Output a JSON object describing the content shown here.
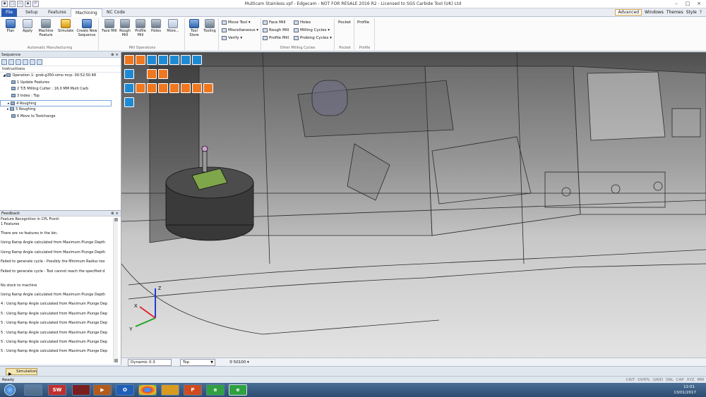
{
  "window": {
    "title": "Multicam Stainless.vpf - Edgecam - NOT FOR RESALE 2016 R2 - Licensed to SGS Carbide Tool (UK) Ltd",
    "controls": {
      "minimize": "–",
      "maximize": "□",
      "close": "×"
    }
  },
  "tabs": [
    "File",
    "Setup",
    "Features",
    "Machining",
    "NC Code"
  ],
  "active_tab": "Machining",
  "right_menu": {
    "advanced": "Advanced",
    "windows": "Windows",
    "themes": "Themes",
    "style": "Style"
  },
  "ribbon": {
    "automatic": {
      "label": "Automatic Manufacturing",
      "buttons": [
        {
          "label": "Plan",
          "icon": "plan-icon"
        },
        {
          "label": "Apply",
          "icon": "apply-icon"
        },
        {
          "label": "Machine Feature",
          "icon": "machine-feature-icon"
        },
        {
          "label": "Simulate",
          "icon": "simulate-icon"
        },
        {
          "label": "Create New Sequence",
          "icon": "new-sequence-icon"
        }
      ]
    },
    "mill_ops": {
      "label": "Mill Operations",
      "buttons": [
        {
          "label": "Face Mill",
          "icon": "face-mill-icon"
        },
        {
          "label": "Rough Mill",
          "icon": "rough-mill-icon"
        },
        {
          "label": "Profile Mill",
          "icon": "profile-mill-icon"
        },
        {
          "label": "Holes",
          "icon": "holes-icon"
        },
        {
          "label": "More...",
          "icon": "more-icon"
        }
      ]
    },
    "tool": {
      "buttons": [
        {
          "label": "Tool Store",
          "icon": "tool-store-icon"
        },
        {
          "label": "Tooling",
          "icon": "tooling-icon"
        }
      ]
    },
    "small": {
      "move_tool": "Move Tool",
      "miscellaneous": "Miscellaneous",
      "verify": "Verify"
    },
    "cycles": {
      "label": "Other Milling Cycles",
      "face_mill": "Face Mill",
      "rough_mill": "Rough Mill",
      "profile_mill": "Profile Mill",
      "holes": "Holes",
      "milling_cycles": "Milling Cycles",
      "probing_cycles": "Probing Cycles"
    },
    "pocket": {
      "button": "Pocket",
      "label": "Pocket"
    },
    "profile": {
      "button": "Profile",
      "label": "Profile"
    }
  },
  "sequence": {
    "title": "Sequence",
    "instructions_header": "Instructions",
    "tree": [
      "Operation 1: grob-g350-simo mcp: 00:52:50.48",
      "1 Update Features",
      "2 T/5 Milling Cutter : 16.0 MM Multi Carb",
      "3 Index : Top",
      "4 Roughing",
      "5 Roughing",
      "6 Move to Toolchange"
    ]
  },
  "feedback": {
    "title": "Feedback",
    "lines": [
      "Feature Recognition in CPL Fronti",
      " 1 Features",
      "",
      "There are no features in the bin.",
      "",
      "Using Ramp Angle calculated from Maximum Plunge Depth",
      "",
      "Using Ramp Angle calculated from Maximum Plunge Depth",
      "",
      "Failed to generate cycle - Possibly the Minimum Radius too",
      "",
      "Failed to generate cycle - Tool cannot reach the specified d",
      "",
      "",
      "No stock to machine",
      "",
      "Using Ramp Angle calculated from Maximum Plunge Depth",
      "",
      "4 : Using Ramp Angle calculated from Maximum Plunge Dep",
      "",
      "5 : Using Ramp Angle calculated from Maximum Plunge Dep",
      "",
      "5 : Using Ramp Angle calculated from Maximum Plunge Dep",
      "",
      "5 : Using Ramp Angle calculated from Maximum Plunge Dep",
      "",
      "5 : Using Ramp Angle calculated from Maximum Plunge Dep",
      "",
      "5 : Using Ramp Angle calculated from Maximum Plunge Dep"
    ]
  },
  "bottom_tab": "Simulation",
  "viewport": {
    "axes": {
      "x": "X",
      "y": "Y",
      "z": "Z"
    },
    "dynamic": "Dynamic 0.3",
    "view": "Top",
    "zoom": "50100"
  },
  "status": {
    "text": "Ready",
    "indicators": [
      "CRIT",
      "OVRTL",
      "GRID",
      "SNL",
      "CAP",
      "XYZ",
      "MM"
    ]
  },
  "taskbar": {
    "apps": [
      {
        "name": "explorer",
        "label": ""
      },
      {
        "name": "solidworks",
        "label": "SW"
      },
      {
        "name": "app-red",
        "label": ""
      },
      {
        "name": "media",
        "label": "▶"
      },
      {
        "name": "outlook",
        "label": "O"
      },
      {
        "name": "chrome",
        "label": ""
      },
      {
        "name": "app-cam",
        "label": ""
      },
      {
        "name": "powerpoint",
        "label": "P"
      },
      {
        "name": "edgecam-1",
        "label": "e"
      },
      {
        "name": "edgecam-2",
        "label": "e"
      }
    ],
    "time": "12:01",
    "date": "13/01/2017"
  },
  "colors": {
    "accent": "#2a5bb5",
    "view_orange": "#f07820",
    "view_blue": "#1f8ad4",
    "axis_x": "#e0242a",
    "axis_y": "#21a021",
    "axis_z": "#1f3bd6"
  }
}
